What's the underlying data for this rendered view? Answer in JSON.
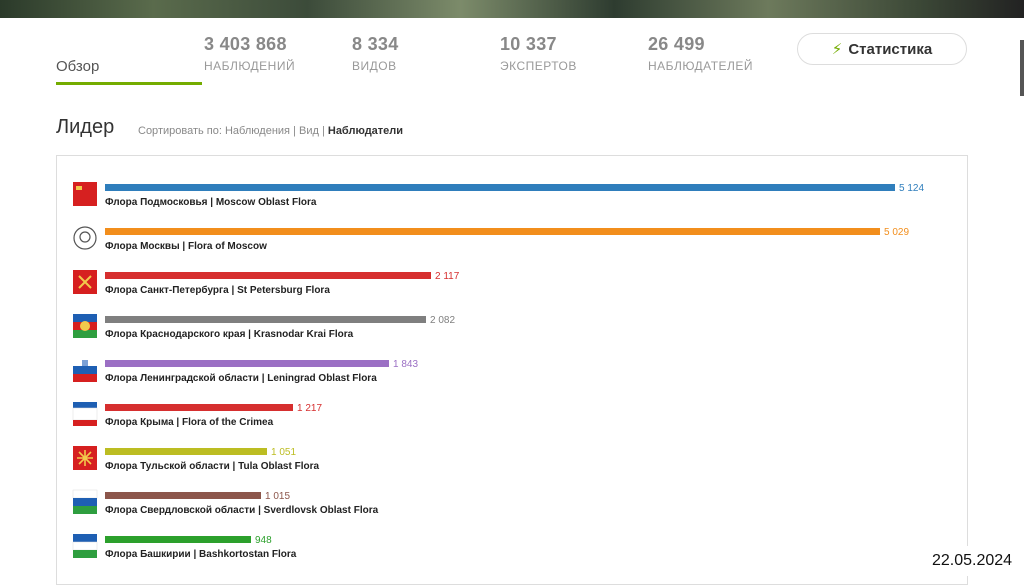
{
  "tabs": {
    "overview": "Обзор"
  },
  "stats": [
    {
      "value": "3 403 868",
      "label": "НАБЛЮДЕНИЙ"
    },
    {
      "value": "8 334",
      "label": "ВИДОВ"
    },
    {
      "value": "10 337",
      "label": "ЭКСПЕРТОВ"
    },
    {
      "value": "26 499",
      "label": "НАБЛЮДАТЕЛЕЙ"
    }
  ],
  "stats_button": {
    "label": "Статистика",
    "icon": "bolt-icon"
  },
  "leaderboard": {
    "title": "Лидер",
    "sort_prefix": "Сортировать по:",
    "sort_options": [
      "Наблюдения",
      "Вид",
      "Наблюдатели"
    ],
    "active_sort": "Наблюдатели"
  },
  "date": "22.05.2024",
  "chart_data": {
    "type": "bar",
    "orientation": "horizontal",
    "categories": [
      "Флора Подмосковья | Moscow Oblast Flora",
      "Флора Москвы | Flora of Moscow",
      "Флора Санкт-Петербурга | St Petersburg Flora",
      "Флора Краснодарского края | Krasnodar Krai Flora",
      "Флора Ленинградской области | Leningrad Oblast Flora",
      "Флора Крыма | Flora of the Crimea",
      "Флора Тульской области | Tula Oblast Flora",
      "Флора Свердловской области | Sverdlovsk Oblast Flora",
      "Флора Башкирии | Bashkortostan Flora"
    ],
    "values": [
      5124,
      5029,
      2117,
      2082,
      1843,
      1217,
      1051,
      1015,
      948
    ],
    "value_labels": [
      "5 124",
      "5 029",
      "2 117",
      "2 082",
      "1 843",
      "1 217",
      "1 051",
      "1 015",
      "948"
    ],
    "colors": [
      "#2f7ebc",
      "#f28e1c",
      "#d62f2f",
      "#7f7f7f",
      "#9b6fc4",
      "#d62f2f",
      "#bcbd22",
      "#8c564b",
      "#2ca02c"
    ],
    "flags": [
      "moscow-oblast-flag",
      "moscow-emblem",
      "st-petersburg-flag",
      "krasnodar-flag",
      "leningrad-flag",
      "crimea-flag",
      "tula-flag",
      "sverdlovsk-flag",
      "bashkortostan-flag"
    ]
  }
}
